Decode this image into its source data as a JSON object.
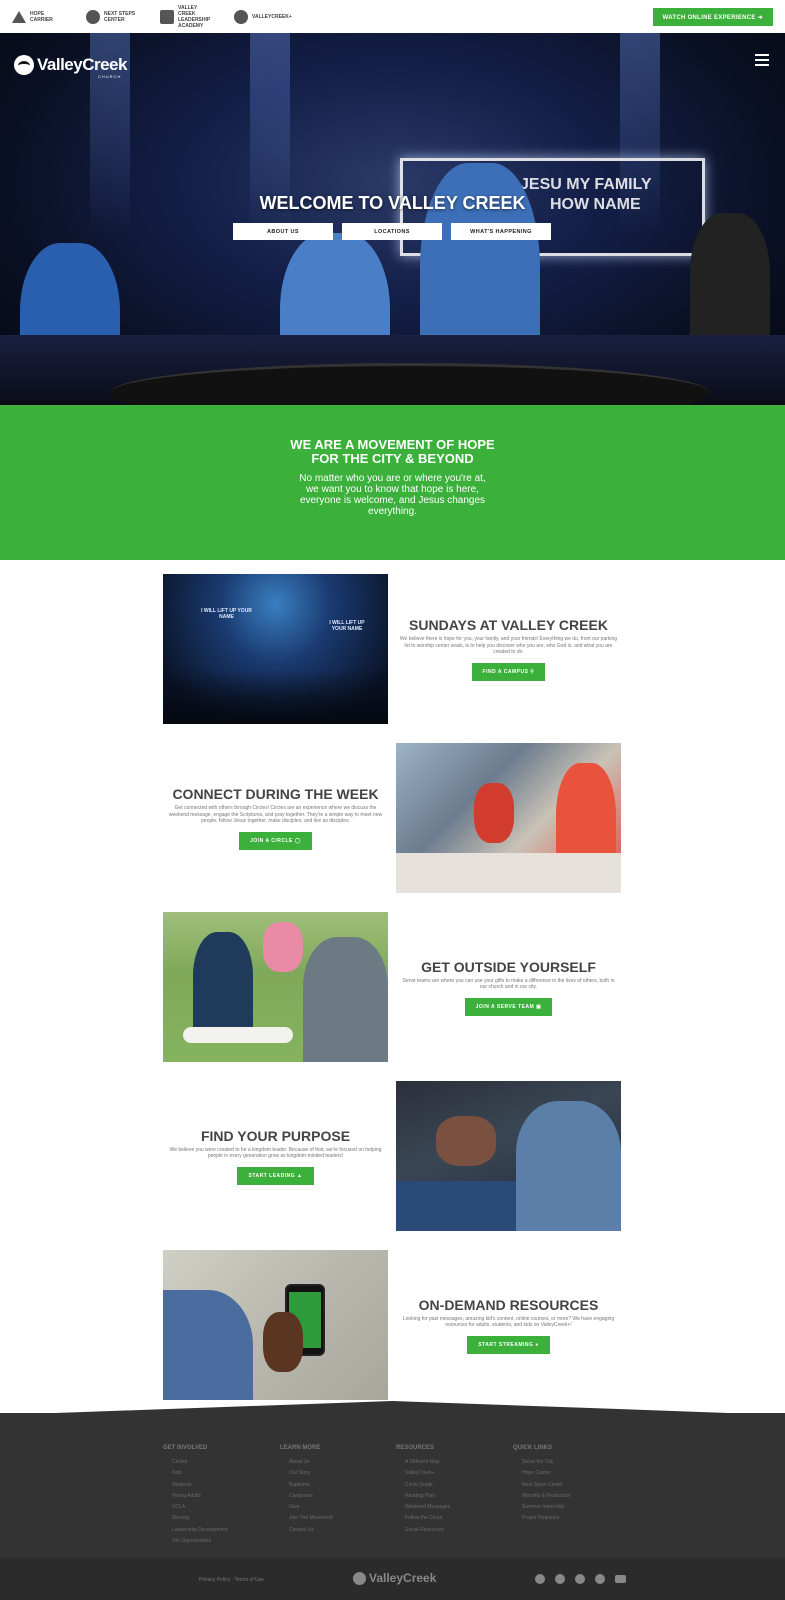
{
  "topbar": {
    "brands": [
      {
        "label": "Hope Carrier",
        "icon": "hope-carrier-icon"
      },
      {
        "label": "Next Steps Center",
        "icon": "next-steps-icon"
      },
      {
        "label": "Valley Creek Leadership Academy",
        "icon": "leadership-academy-icon"
      },
      {
        "label": "ValleyCreek+",
        "icon": "valleycreek-plus-icon"
      }
    ],
    "watch_label": "Watch Online Experience ➜"
  },
  "hero": {
    "logo": "ValleyCreek",
    "logo_sub": "CHURCH",
    "sign_text_line1": "JESU  MY FAMILY",
    "sign_text_line2": "HOW NAME",
    "title": "Welcome to Valley Creek",
    "buttons": [
      "About Us",
      "Locations",
      "What's Happening"
    ]
  },
  "mission": {
    "heading_line1": "We are a movement of hope",
    "heading_line2": "for the city & beyond",
    "body": "No matter who you are or where you're at, we want you to know that hope is here, everyone is welcome, and Jesus changes everything."
  },
  "features": [
    {
      "title": "Sundays at Valley Creek",
      "body": "We believe there is hope for you, your family, and your friends! Everything we do, from our parking lot to worship center seats, is to help you discover who you are, who God is, and what you are created to do.",
      "button": "Find a Campus ⚲",
      "image_caption_1": "I WILL LIFT UP YOUR NAME",
      "image_caption_2": "I WILL LIFT UP YOUR NAME"
    },
    {
      "title": "Connect During the Week",
      "body": "Get connected with others through Circles! Circles are an experience where we discuss the weekend message, engage the Scriptures, and pray together. They're a simple way to meet new people, follow Jesus together, make disciples, and live as disciples.",
      "button": "Join a Circle ◯"
    },
    {
      "title": "Get Outside Yourself",
      "body": "Serve teams are where you can use your gifts to make a difference in the lives of others, both in our church and in our city.",
      "button": "Join a Serve Team ▣"
    },
    {
      "title": "Find Your Purpose",
      "body": "We believe you were created to be a kingdom leader. Because of that, we're focused on helping people in every generation grow as kingdom-minded leaders!",
      "button": "Start Leading ▲"
    },
    {
      "title": "On-Demand Resources",
      "body": "Looking for past messages, amazing kid's content, online courses, or more? We have engaging resources for adults, students, and kids on ValleyCreek+!",
      "button": "Start Streaming ●"
    }
  ],
  "footer": {
    "columns": [
      {
        "title": "Get Involved",
        "items": [
          "Circles",
          "Kids",
          "Students",
          "Young Adults",
          "VCLA",
          "Serving",
          "Leadership Development",
          "Job Opportunities"
        ]
      },
      {
        "title": "Learn More",
        "items": [
          "About Us",
          "Our Story",
          "Baptisms",
          "Campuses",
          "Give",
          "Join The Movement",
          "Contact Us"
        ]
      },
      {
        "title": "Resources",
        "items": [
          "A Different Way",
          "ValleyCreek+",
          "Circle Guide",
          "Reading Plan",
          "Weekend Messages",
          "Follow the Cloud",
          "Social Resources"
        ]
      },
      {
        "title": "Quick Links",
        "items": [
          "Serve the City",
          "Hope Carrier",
          "Next Steps Center",
          "Worship & Production",
          "Summer Internship",
          "Prayer Requests"
        ]
      }
    ],
    "legal": "Privacy Policy · Terms of Use",
    "logo": "ValleyCreek",
    "social_icons": [
      "facebook-icon",
      "instagram-icon",
      "chat-icon",
      "phone-icon",
      "youtube-icon"
    ]
  },
  "colors": {
    "brand_green": "#3bb03b",
    "footer_dark": "#333333"
  }
}
